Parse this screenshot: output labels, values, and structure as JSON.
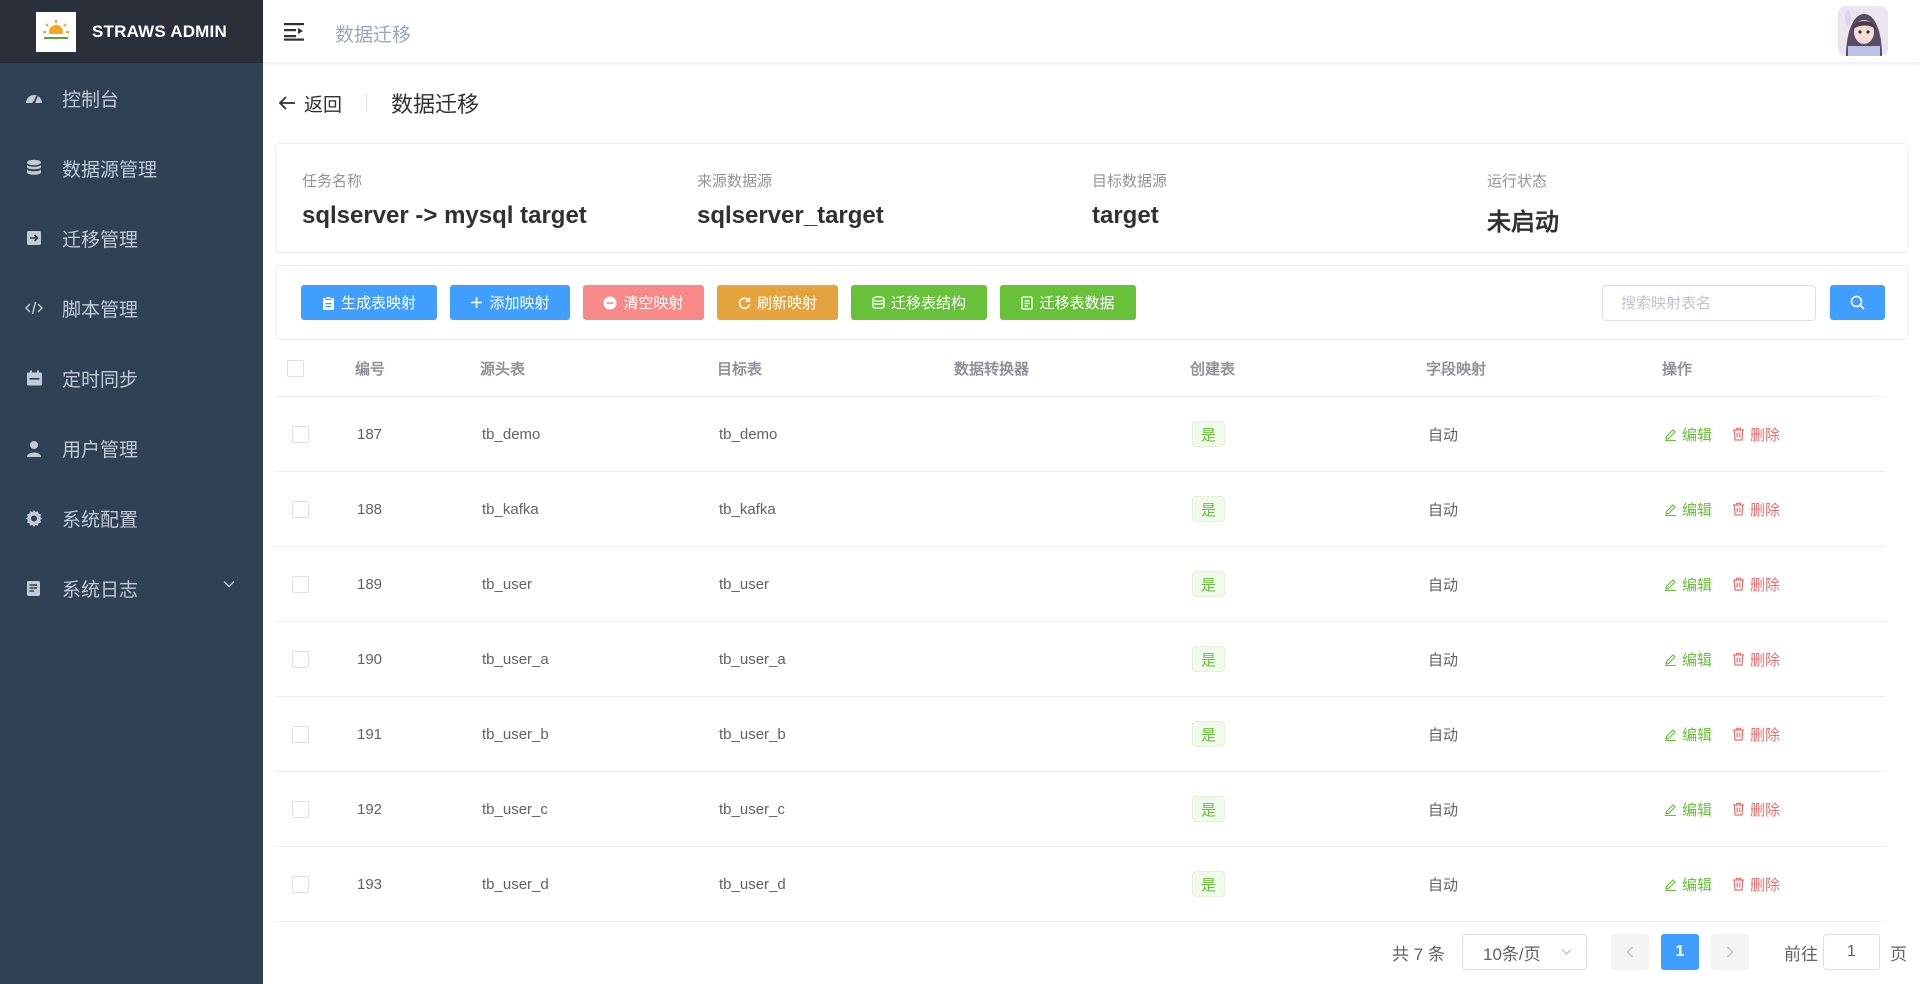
{
  "app": {
    "title": "STRAWS ADMIN"
  },
  "sidebar": {
    "items": [
      {
        "label": "控制台",
        "icon": "dashboard-icon"
      },
      {
        "label": "数据源管理",
        "icon": "database-icon"
      },
      {
        "label": "迁移管理",
        "icon": "migrate-icon"
      },
      {
        "label": "脚本管理",
        "icon": "code-icon"
      },
      {
        "label": "定时同步",
        "icon": "calendar-icon"
      },
      {
        "label": "用户管理",
        "icon": "user-icon"
      },
      {
        "label": "系统配置",
        "icon": "gear-icon"
      },
      {
        "label": "系统日志",
        "icon": "log-icon"
      }
    ]
  },
  "header": {
    "breadcrumb": "数据迁移"
  },
  "page": {
    "back_label": "返回",
    "title": "数据迁移"
  },
  "info": {
    "task_name_label": "任务名称",
    "task_name": "sqlserver -> mysql target",
    "source_label": "来源数据源",
    "source": "sqlserver_target",
    "target_label": "目标数据源",
    "target": "target",
    "status_label": "运行状态",
    "status": "未启动"
  },
  "toolbar": {
    "generate": "生成表映射",
    "add": "添加映射",
    "clear": "清空映射",
    "refresh": "刷新映射",
    "migrate_structure": "迁移表结构",
    "migrate_data": "迁移表数据",
    "search_placeholder": "搜索映射表名"
  },
  "colors": {
    "primary": "#409eff",
    "danger": "#f78989",
    "warning": "#e6a23c",
    "success": "#67c23a",
    "sidebar": "#304156"
  },
  "table": {
    "headers": {
      "id": "编号",
      "source": "源头表",
      "target": "目标表",
      "converter": "数据转换器",
      "create": "创建表",
      "field_map": "字段映射",
      "ops": "操作"
    },
    "edit_label": "编辑",
    "delete_label": "删除",
    "rows": [
      {
        "id": "187",
        "source": "tb_demo",
        "target": "tb_demo",
        "converter": "",
        "create": "是",
        "field_map": "自动"
      },
      {
        "id": "188",
        "source": "tb_kafka",
        "target": "tb_kafka",
        "converter": "",
        "create": "是",
        "field_map": "自动"
      },
      {
        "id": "189",
        "source": "tb_user",
        "target": "tb_user",
        "converter": "",
        "create": "是",
        "field_map": "自动"
      },
      {
        "id": "190",
        "source": "tb_user_a",
        "target": "tb_user_a",
        "converter": "",
        "create": "是",
        "field_map": "自动"
      },
      {
        "id": "191",
        "source": "tb_user_b",
        "target": "tb_user_b",
        "converter": "",
        "create": "是",
        "field_map": "自动"
      },
      {
        "id": "192",
        "source": "tb_user_c",
        "target": "tb_user_c",
        "converter": "",
        "create": "是",
        "field_map": "自动"
      },
      {
        "id": "193",
        "source": "tb_user_d",
        "target": "tb_user_d",
        "converter": "",
        "create": "是",
        "field_map": "自动"
      }
    ]
  },
  "pagination": {
    "total": "共 7 条",
    "page_size": "10条/页",
    "current": "1",
    "jump_prefix": "前往",
    "jump_value": "1",
    "jump_suffix": "页"
  }
}
